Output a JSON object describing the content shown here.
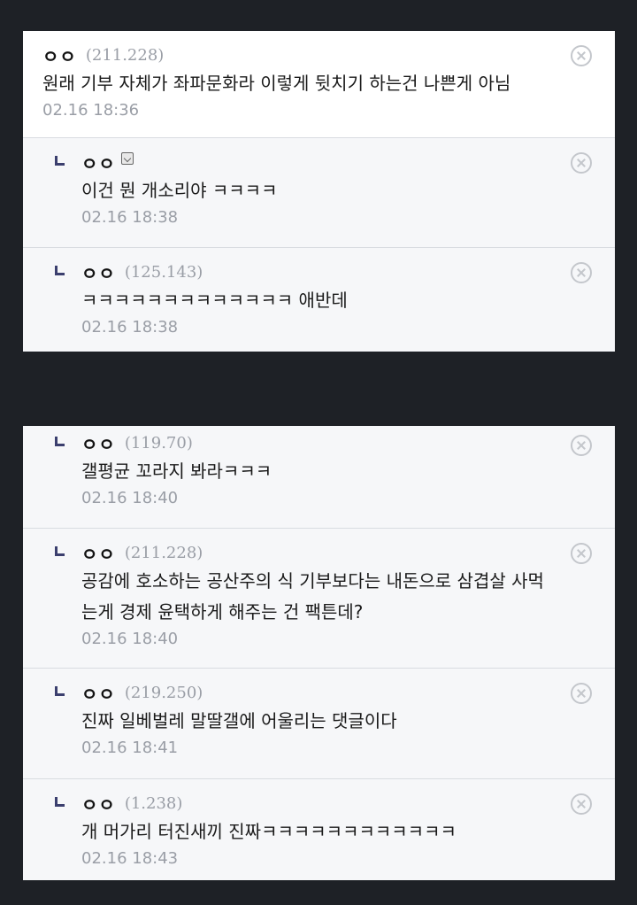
{
  "panel_1": {
    "comments": [
      {
        "nick": "ㅇㅇ",
        "ip": "(211.228)",
        "text": "원래 기부 자체가 좌파문화라 이렇게 뒷치기 하는건 나쁜게 아님",
        "time": "02.16 18:36"
      },
      {
        "nick": "ㅇㅇ",
        "ip": "",
        "member_icon": "member-badge-icon",
        "text": "이건 뭔 개소리야 ㅋㅋㅋㅋ",
        "time": "02.16 18:38"
      },
      {
        "nick": "ㅇㅇ",
        "ip": "(125.143)",
        "text": "ㅋㅋㅋㅋㅋㅋㅋㅋㅋㅋㅋㅋㅋ 애반데",
        "time": "02.16 18:38"
      }
    ]
  },
  "panel_2": {
    "comments": [
      {
        "nick": "ㅇㅇ",
        "ip": "(119.70)",
        "text": "갤평균 꼬라지 봐라ㅋㅋㅋ",
        "time": "02.16 18:40"
      },
      {
        "nick": "ㅇㅇ",
        "ip": "(211.228)",
        "text_line1": "공감에 호소하는 공산주의 식 기부보다는 내돈으로 삼겹살 사먹",
        "text_line2": "는게 경제 윤택하게 해주는 건 팩튼데?",
        "time": "02.16 18:40"
      },
      {
        "nick": "ㅇㅇ",
        "ip": "(219.250)",
        "text": "진짜 일베벌레 말딸갤에 어울리는 댓글이다",
        "time": "02.16 18:41"
      },
      {
        "nick": "ㅇㅇ",
        "ip": "(1.238)",
        "text": "개 머가리 터진새끼 진짜ㅋㅋㅋㅋㅋㅋㅋㅋㅋㅋㅋㅋ",
        "time": "02.16 18:43"
      }
    ]
  },
  "colors": {
    "background": "#1e2126",
    "panel": "#f6f7f9",
    "reply_mark": "#3b3f6e",
    "meta_text": "#9a9ea6"
  }
}
